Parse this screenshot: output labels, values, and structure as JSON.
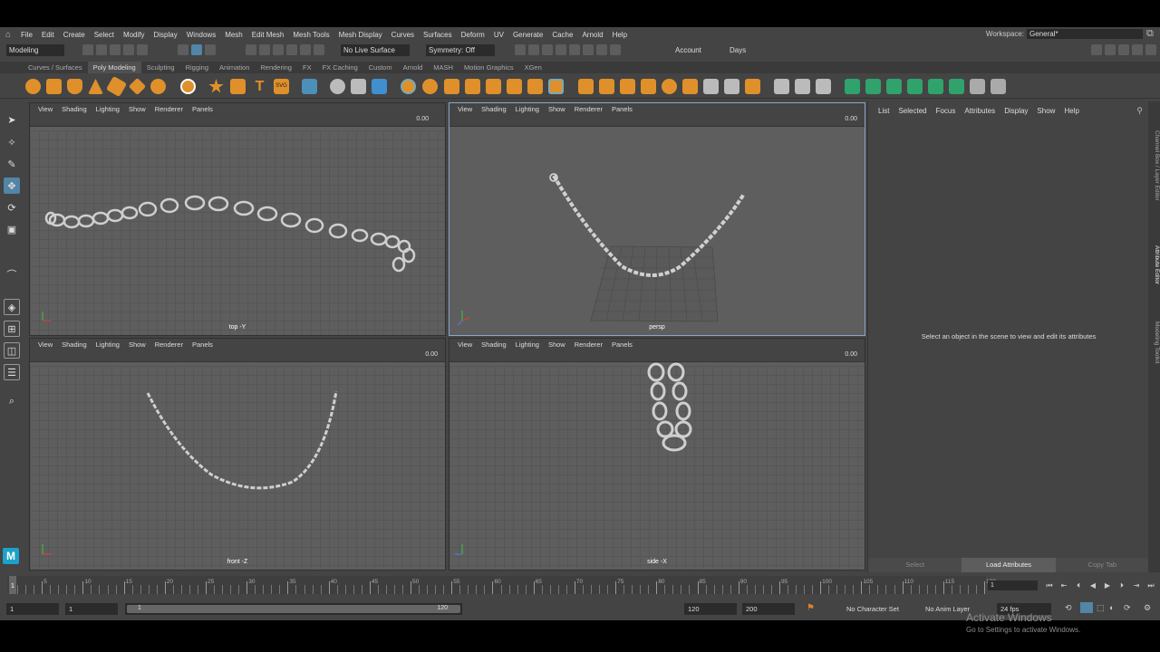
{
  "menubar": {
    "items": [
      "File",
      "Edit",
      "Create",
      "Select",
      "Modify",
      "Display",
      "Windows",
      "Mesh",
      "Edit Mesh",
      "Mesh Tools",
      "Mesh Display",
      "Curves",
      "Surfaces",
      "Deform",
      "UV",
      "Generate",
      "Cache",
      "Arnold",
      "Help"
    ],
    "workspace_label": "Workspace:",
    "workspace_value": "General*"
  },
  "statusline": {
    "mode": "Modeling",
    "live_surface": "No Live Surface",
    "symmetry": "Symmetry: Off",
    "account": "Account",
    "days": "Days"
  },
  "shelf": {
    "tabs": [
      "Curves / Surfaces",
      "Poly Modeling",
      "Sculpting",
      "Rigging",
      "Animation",
      "Rendering",
      "FX",
      "FX Caching",
      "Custom",
      "Arnold",
      "MASH",
      "Motion Graphics",
      "XGen"
    ],
    "active_tab": "Poly Modeling"
  },
  "viewports": {
    "menu": [
      "View",
      "Shading",
      "Lighting",
      "Show",
      "Renderer",
      "Panels"
    ],
    "top_left": {
      "camera": "top -Y",
      "value": "0.00"
    },
    "top_right": {
      "camera": "persp",
      "value": "0.00"
    },
    "bottom_left": {
      "camera": "front -Z",
      "value": "0.00"
    },
    "bottom_right": {
      "camera": "side -X",
      "value": "0.00"
    }
  },
  "attribute_editor": {
    "menu": [
      "List",
      "Selected",
      "Focus",
      "Attributes",
      "Display",
      "Show",
      "Help"
    ],
    "hint": "Select an object in the scene to view and edit its attributes",
    "buttons": [
      "Select",
      "Load Attributes",
      "Copy Tab"
    ]
  },
  "side_tabs": [
    "Channel Box / Layer Editor",
    "Attribute Editor",
    "Modeling Toolkit"
  ],
  "timeline": {
    "tick_labels": [
      "5",
      "10",
      "15",
      "20",
      "25",
      "30",
      "35",
      "40",
      "45",
      "50",
      "55",
      "60",
      "65",
      "70",
      "75",
      "80",
      "85",
      "90",
      "95",
      "100",
      "105",
      "110",
      "115",
      "120"
    ],
    "current_frame": "1",
    "start_marker": "1"
  },
  "range": {
    "start": "1",
    "playback_start": "1",
    "slider_start": "1",
    "slider_end": "120",
    "playback_end": "120",
    "end": "200",
    "character_set": "No Character Set",
    "anim_layer": "No Anim Layer",
    "fps": "24 fps"
  },
  "watermark": {
    "title": "Activate Windows",
    "subtitle": "Go to Settings to activate Windows."
  },
  "logo": "M"
}
